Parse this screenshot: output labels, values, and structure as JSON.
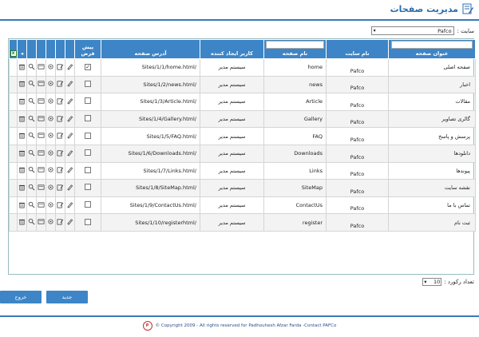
{
  "header": {
    "title": "مدیریت صفحات",
    "icon": "edit-document-icon"
  },
  "site_selector": {
    "label": "سایت :",
    "value": "Pafco"
  },
  "columns": {
    "page_title": "عنوان صفحه",
    "site_name": "نام سایت",
    "page_name": "نام صفحه",
    "creator": "کاربر ایجاد کننده",
    "address": "آدرس صفحه",
    "default": "پیش فرض"
  },
  "rows": [
    {
      "title": "صفحه اصلی",
      "site": "Pafco",
      "page": "home",
      "creator": "سیستم مدیر",
      "address": "Sites/1/1/home.html/",
      "is_default": true
    },
    {
      "title": "اخبار",
      "site": "Pafco",
      "page": "news",
      "creator": "سیستم مدیر",
      "address": "Sites/1/2/news.html/",
      "is_default": false
    },
    {
      "title": "مقالات",
      "site": "Pafco",
      "page": "Article",
      "creator": "سیستم مدیر",
      "address": "Sites/1/3/Article.html/",
      "is_default": false
    },
    {
      "title": "گالری تصاویر",
      "site": "Pafco",
      "page": "Gallery",
      "creator": "سیستم مدیر",
      "address": "Sites/1/4/Gallery.html/",
      "is_default": false
    },
    {
      "title": "پرسش و پاسخ",
      "site": "Pafco",
      "page": "FAQ",
      "creator": "سیستم مدیر",
      "address": "Sites/1/5/FAQ.html/",
      "is_default": false
    },
    {
      "title": "دانلودها",
      "site": "Pafco",
      "page": "Downloads",
      "creator": "سیستم مدیر",
      "address": "Sites/1/6/Downloads.html/",
      "is_default": false
    },
    {
      "title": "پیوندها",
      "site": "Pafco",
      "page": "Links",
      "creator": "سیستم مدیر",
      "address": "Sites/1/7/Links.html/",
      "is_default": false
    },
    {
      "title": "نقشه سایت",
      "site": "Pafco",
      "page": "SiteMap",
      "creator": "سیستم مدیر",
      "address": "Sites/1/8/SiteMap.html/",
      "is_default": false
    },
    {
      "title": "تماس با ما",
      "site": "Pafco",
      "page": "ContactUs",
      "creator": "سیستم مدیر",
      "address": "Sites/1/9/ContactUs.html/",
      "is_default": false
    },
    {
      "title": "ثبت نام",
      "site": "Pafco",
      "page": "register",
      "creator": "سیستم مدیر",
      "address": "Sites/1/10/registerhtml/",
      "is_default": false
    }
  ],
  "row_actions": [
    "edit-icon",
    "content-edit-icon",
    "settings-icon",
    "view-icon",
    "search-icon",
    "delete-icon"
  ],
  "pager": {
    "label": "تعداد رکورد :",
    "value": "10"
  },
  "buttons": {
    "new": "جدید",
    "exit": "خروج"
  },
  "footer": {
    "text": "© Copyright 2009 - All rights reserved for Padhouhesh Afzar Farda -Contact PAFCo",
    "logo_text": "PAFCo"
  },
  "colors": {
    "accent": "#3d85c6",
    "line": "#3b78b8",
    "title": "#2b6cb0"
  }
}
